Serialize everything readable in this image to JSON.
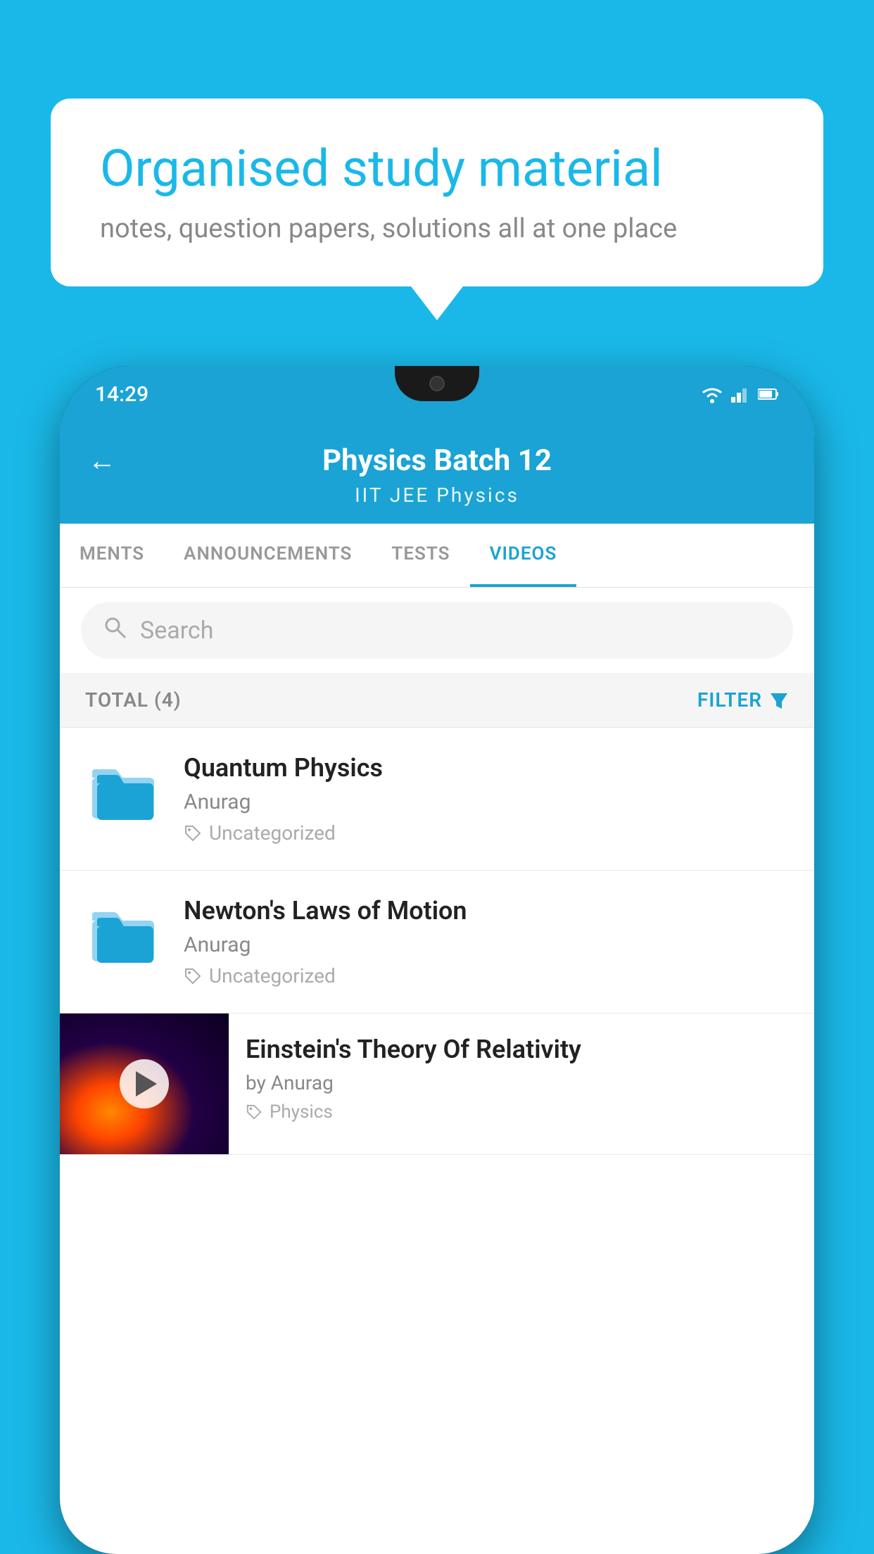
{
  "background_color": "#1ab8e8",
  "speech_bubble": {
    "title": "Organised study material",
    "subtitle": "notes, question papers, solutions all at one place"
  },
  "phone": {
    "status_bar": {
      "time": "14:29",
      "wifi_icon": "wifi",
      "signal_icon": "signal",
      "battery_icon": "battery"
    },
    "header": {
      "back_label": "←",
      "title": "Physics Batch 12",
      "subtitle_part1": "IIT JEE",
      "subtitle_part2": "Physics"
    },
    "tabs": [
      {
        "label": "MENTS",
        "active": false
      },
      {
        "label": "ANNOUNCEMENTS",
        "active": false
      },
      {
        "label": "TESTS",
        "active": false
      },
      {
        "label": "VIDEOS",
        "active": true
      }
    ],
    "search": {
      "placeholder": "Search"
    },
    "filter_row": {
      "total_label": "TOTAL (4)",
      "filter_label": "FILTER"
    },
    "videos": [
      {
        "title": "Quantum Physics",
        "author": "Anurag",
        "tag": "Uncategorized",
        "type": "folder"
      },
      {
        "title": "Newton's Laws of Motion",
        "author": "Anurag",
        "tag": "Uncategorized",
        "type": "folder"
      },
      {
        "title": "Einstein's Theory Of Relativity",
        "author": "by Anurag",
        "tag": "Physics",
        "type": "thumbnail"
      }
    ]
  }
}
